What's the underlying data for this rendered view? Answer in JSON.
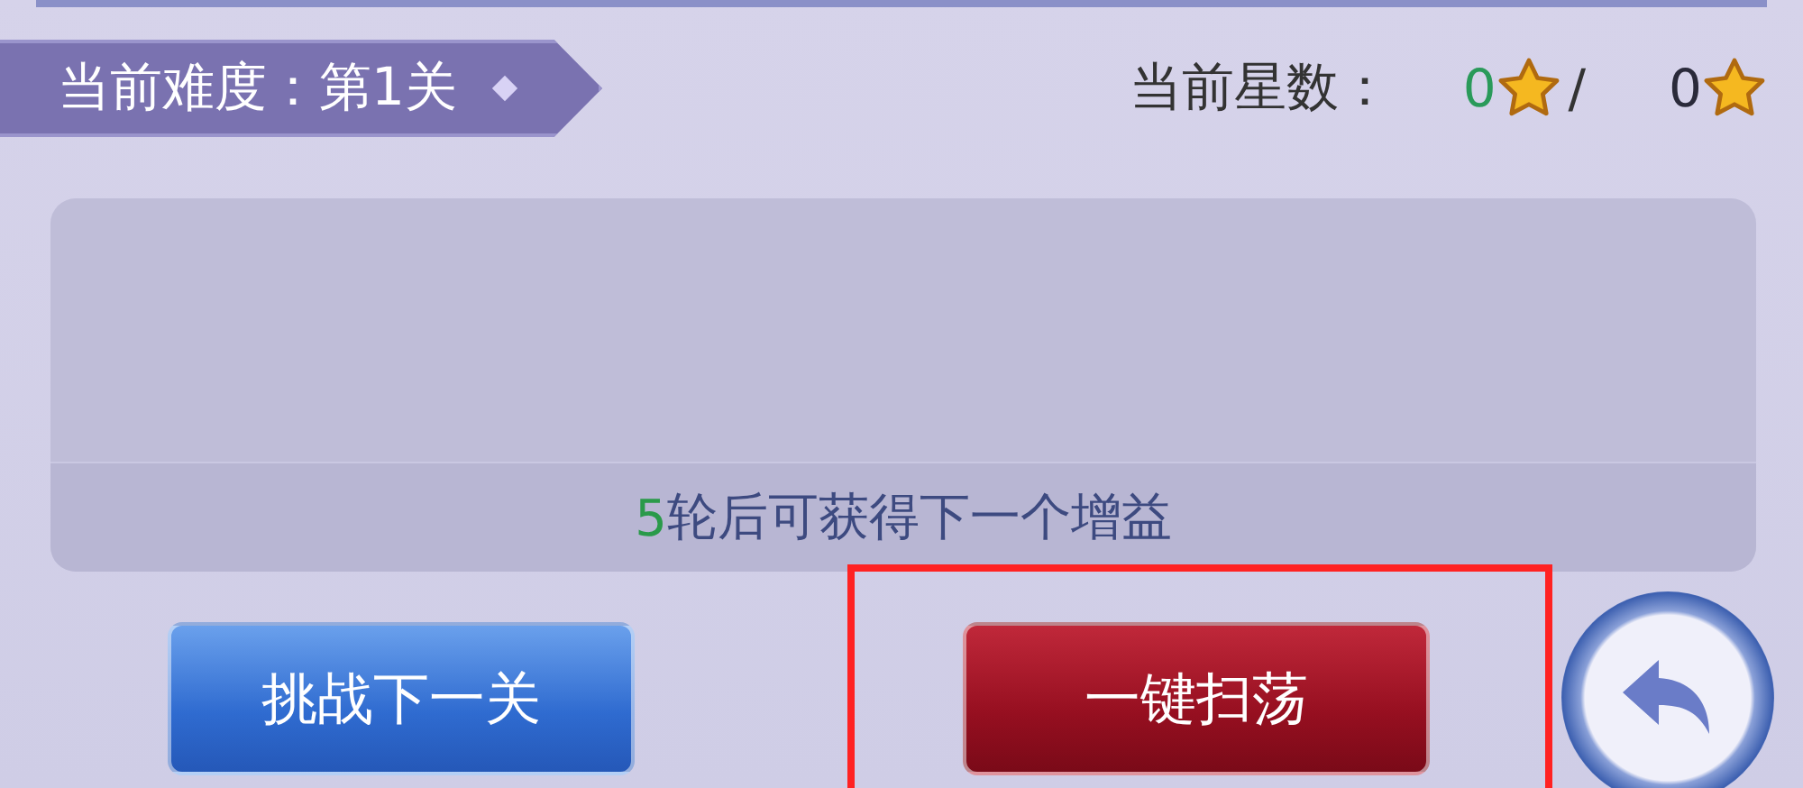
{
  "difficulty": {
    "label": "当前难度：第1关"
  },
  "stars": {
    "label": "当前星数：",
    "current": "0",
    "separator": "/",
    "total": "0"
  },
  "buff_note": {
    "count": "5",
    "text": "轮后可获得下一个增益"
  },
  "buttons": [
    {
      "label": "挑战下一关",
      "kind": "blue",
      "highlighted": false
    },
    {
      "label": "一键扫荡",
      "kind": "red",
      "highlighted": true
    }
  ]
}
